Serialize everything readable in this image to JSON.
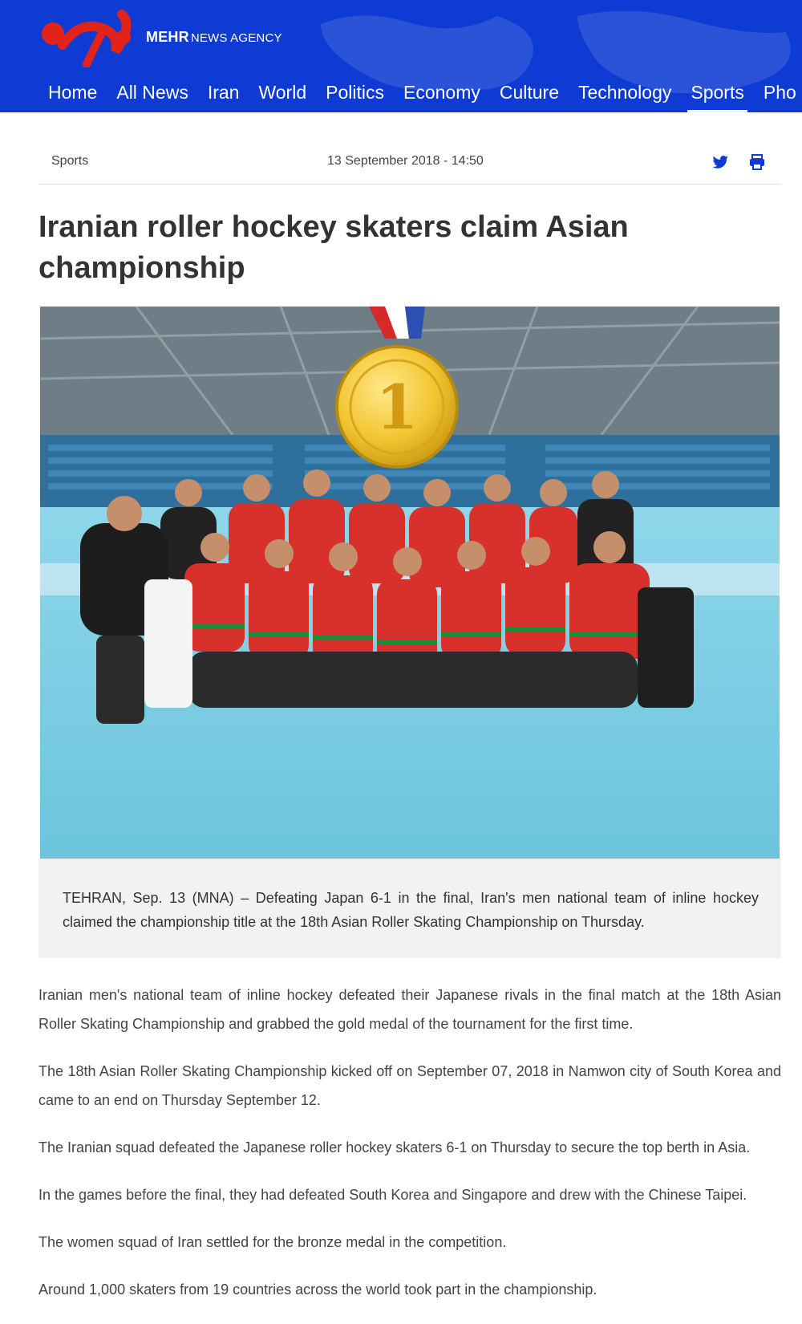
{
  "header": {
    "brand_name": "MEHR",
    "brand_suffix": "NEWS AGENCY",
    "bg_color": "#0d3bd3",
    "logo_color": "#e2231a"
  },
  "nav": {
    "items": [
      {
        "label": "Home"
      },
      {
        "label": "All News"
      },
      {
        "label": "Iran"
      },
      {
        "label": "World"
      },
      {
        "label": "Politics"
      },
      {
        "label": "Economy"
      },
      {
        "label": "Culture"
      },
      {
        "label": "Technology"
      },
      {
        "label": "Sports",
        "active": true
      },
      {
        "label": "Pho"
      }
    ]
  },
  "article": {
    "category": "Sports",
    "date": "13 September 2018 - 14:50",
    "title": "Iranian roller hockey skaters claim Asian championship",
    "image": {
      "icons": [
        "gold-medal-icon"
      ]
    },
    "lead": "TEHRAN, Sep. 13 (MNA) – Defeating Japan 6-1 in the final, Iran's men national team of inline hockey claimed the championship title at the 18th Asian Roller Skating Championship on Thursday.",
    "paragraphs": [
      "Iranian men's national team of inline hockey defeated their Japanese rivals in the final match at the 18th Asian Roller Skating Championship and grabbed the gold medal of the tournament for the first time.",
      "The 18th Asian Roller Skating Championship kicked off on September 07, 2018 in Namwon city of South Korea and came to an end on Thursday September 12.",
      "The Iranian squad defeated the Japanese roller hockey skaters 6-1 on Thursday to secure the top berth in Asia.",
      "In the games before the final, they had defeated South Korea and Singapore and drew with the Chinese Taipei.",
      "The women squad of Iran settled for the bronze medal in the competition.",
      "Around 1,000 skaters from 19 countries across the world took part in the championship."
    ]
  },
  "icons": {
    "twitter": "twitter-icon",
    "print": "print-icon",
    "accent": "#0d3bd3"
  }
}
